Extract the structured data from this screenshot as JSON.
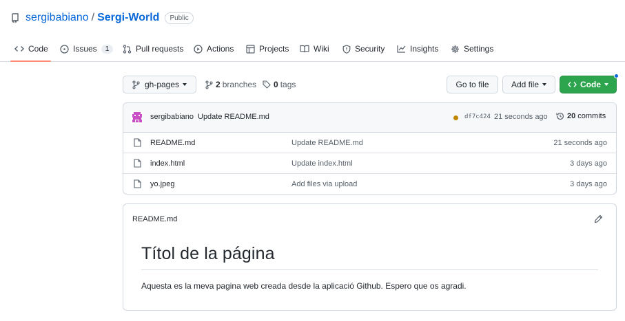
{
  "repo": {
    "owner": "sergibabiano",
    "separator": "/",
    "name": "Sergi-World",
    "visibility": "Public"
  },
  "tabs": [
    {
      "label": "Code",
      "icon": "code-icon",
      "selected": true
    },
    {
      "label": "Issues",
      "icon": "issue-icon",
      "counter": "1"
    },
    {
      "label": "Pull requests",
      "icon": "pull-request-icon"
    },
    {
      "label": "Actions",
      "icon": "play-icon"
    },
    {
      "label": "Projects",
      "icon": "table-icon"
    },
    {
      "label": "Wiki",
      "icon": "book-icon"
    },
    {
      "label": "Security",
      "icon": "shield-icon"
    },
    {
      "label": "Insights",
      "icon": "graph-icon"
    },
    {
      "label": "Settings",
      "icon": "gear-icon"
    }
  ],
  "toolbar": {
    "branch": "gh-pages",
    "branches_count": "2",
    "branches_label": "branches",
    "tags_count": "0",
    "tags_label": "tags",
    "go_to_file": "Go to file",
    "add_file": "Add file",
    "code": "Code"
  },
  "commit": {
    "author": "sergibabiano",
    "message": "Update README.md",
    "sha": "df7c424",
    "time": "21 seconds ago",
    "count": "20",
    "count_label": "commits",
    "status_color": "#bf8700"
  },
  "files": [
    {
      "name": "README.md",
      "message": "Update README.md",
      "age": "21 seconds ago"
    },
    {
      "name": "index.html",
      "message": "Update index.html",
      "age": "3 days ago"
    },
    {
      "name": "yo.jpeg",
      "message": "Add files via upload",
      "age": "3 days ago"
    }
  ],
  "readme": {
    "filename": "README.md",
    "heading": "Títol de la página",
    "paragraph": "Aquesta es la meva pagina web creada desde la aplicació Github. Espero que os agradi."
  },
  "colors": {
    "accent": "#0969da",
    "primary_button": "#2da44e",
    "tab_underline": "#fd8c73"
  }
}
